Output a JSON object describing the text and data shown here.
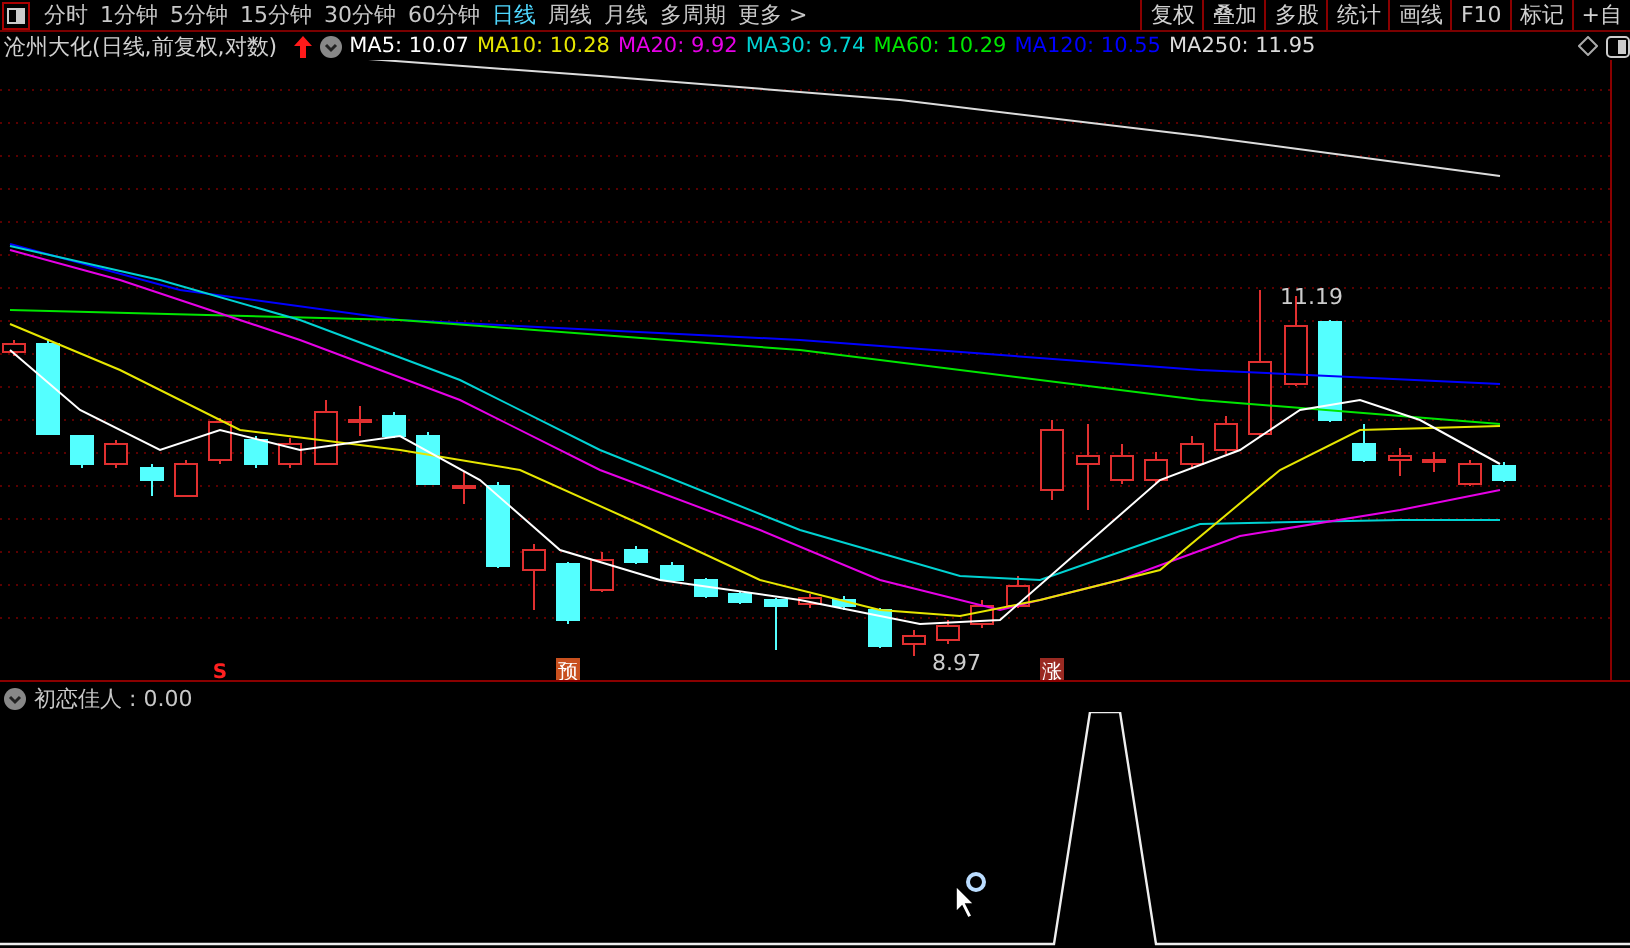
{
  "toolbar": {
    "periods": [
      {
        "label": "分时",
        "selected": false
      },
      {
        "label": "1分钟",
        "selected": false
      },
      {
        "label": "5分钟",
        "selected": false
      },
      {
        "label": "15分钟",
        "selected": false
      },
      {
        "label": "30分钟",
        "selected": false
      },
      {
        "label": "60分钟",
        "selected": false
      },
      {
        "label": "日线",
        "selected": true
      },
      {
        "label": "周线",
        "selected": false
      },
      {
        "label": "月线",
        "selected": false
      },
      {
        "label": "多周期",
        "selected": false
      },
      {
        "label": "更多 >",
        "selected": false
      }
    ],
    "buttons": [
      "复权",
      "叠加",
      "多股",
      "统计",
      "画线",
      "F10",
      "标记",
      "+自"
    ]
  },
  "legend": {
    "title": "沧州大化(日线,前复权,对数)",
    "averages": [
      {
        "label": "MA5: 10.07",
        "color": "#ffffff"
      },
      {
        "label": "MA10: 10.28",
        "color": "#e6e600"
      },
      {
        "label": "MA20: 9.92",
        "color": "#e600e6"
      },
      {
        "label": "MA30: 9.74",
        "color": "#00d2d2"
      },
      {
        "label": "MA60: 10.29",
        "color": "#00e600"
      },
      {
        "label": "MA120: 10.55",
        "color": "#0000ff"
      },
      {
        "label": "MA250: 11.95",
        "color": "#dcdcdc"
      }
    ]
  },
  "chart": {
    "high_label": "11.19",
    "low_label": "8.97",
    "signals": [
      {
        "kind": "letter",
        "text": "S",
        "color": "#ff2020"
      },
      {
        "kind": "tag",
        "text": "预",
        "color": "#c8501e"
      },
      {
        "kind": "tag",
        "text": "涨",
        "color": "#9a2a22"
      }
    ]
  },
  "indicator": {
    "title": "初恋佳人 : 0.00"
  }
}
